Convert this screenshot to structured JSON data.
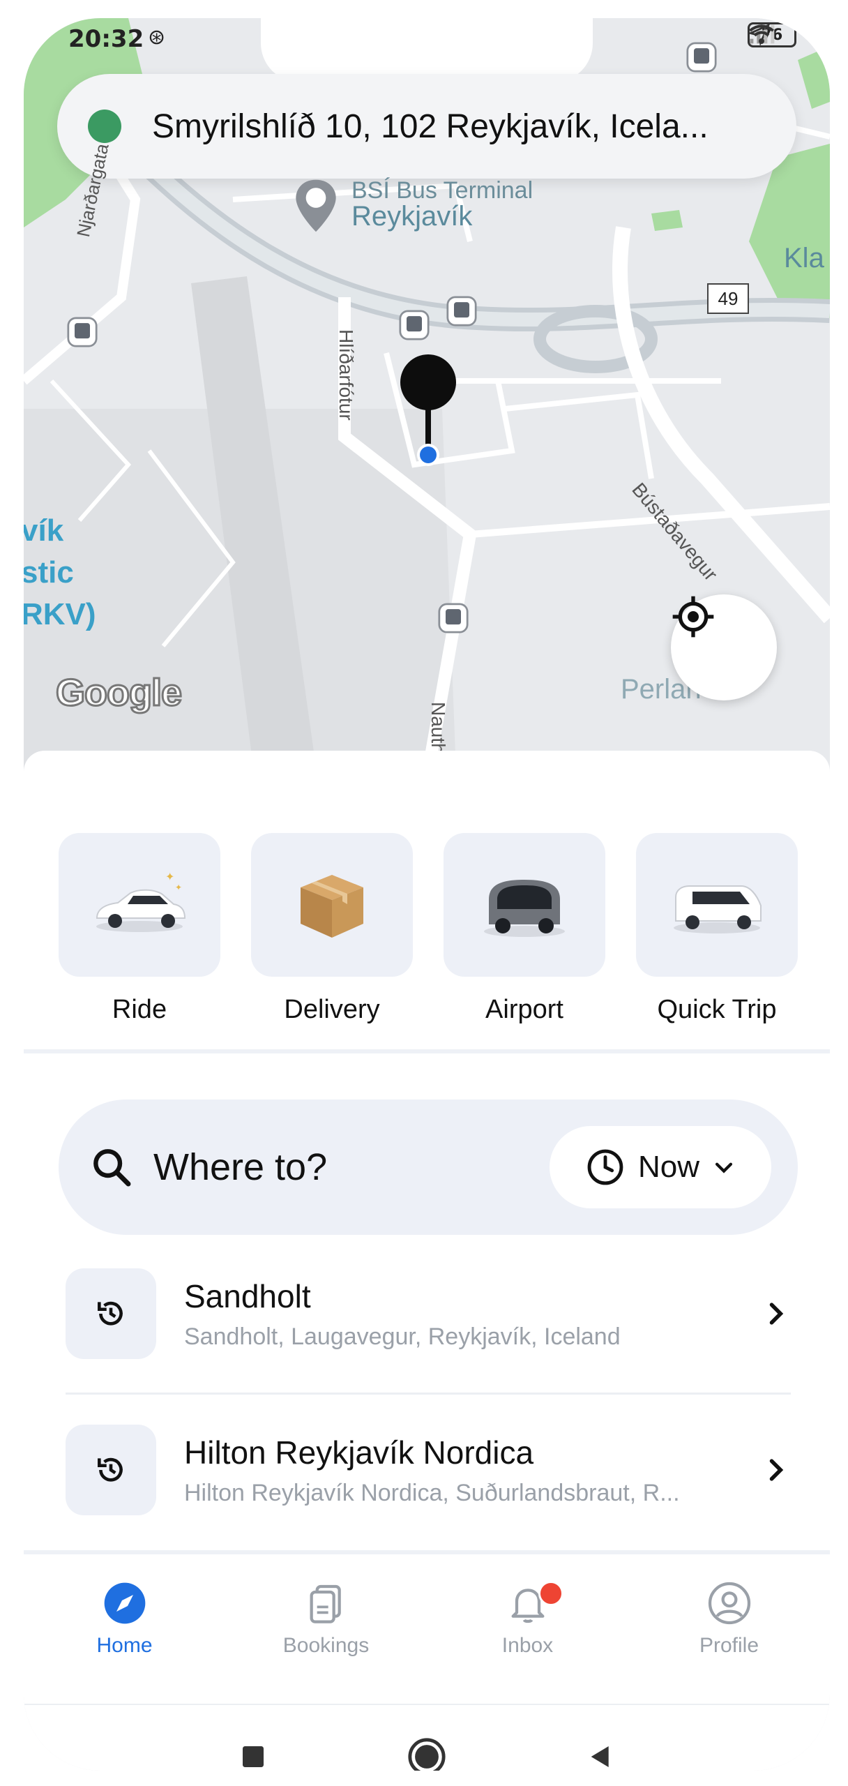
{
  "status_bar": {
    "time": "20:32",
    "sync_glyph": "⊛",
    "battery": "76"
  },
  "map": {
    "address": "Smyrilshlíð 10, 102 Reykjavík, Icela...",
    "labels": {
      "bsi": "BSÍ Bus Terminal",
      "reykjavik": "Reykjavík",
      "njardargata": "Njarðargata",
      "hlidarfotur": "Hlíðarfótur",
      "bustadavegur": "Bústaðavegur",
      "nauth": "Nauth",
      "perlan": "Perlan",
      "airport_1": "vík",
      "airport_2": "stic",
      "airport_3": "RKV)",
      "kla": "Kla",
      "route": "49"
    },
    "attribution": "Google",
    "colors": {
      "road": "#ffffff",
      "park": "#a8dba0",
      "label": "#5a8a9c",
      "accent": "#3b9a62"
    }
  },
  "services": [
    {
      "label": "Ride"
    },
    {
      "label": "Delivery"
    },
    {
      "label": "Airport"
    },
    {
      "label": "Quick Trip"
    }
  ],
  "search": {
    "placeholder": "Where to?",
    "time_label": "Now"
  },
  "recents": [
    {
      "title": "Sandholt",
      "subtitle": "Sandholt, Laugavegur, Reykjavík, Iceland"
    },
    {
      "title": "Hilton Reykjavík Nordica",
      "subtitle": "Hilton Reykjavík Nordica, Suðurlandsbraut, R..."
    }
  ],
  "tabs": [
    {
      "label": "Home",
      "icon": "compass-icon",
      "active": true
    },
    {
      "label": "Bookings",
      "icon": "documents-icon",
      "active": false
    },
    {
      "label": "Inbox",
      "icon": "bell-icon",
      "active": false
    },
    {
      "label": "Profile",
      "icon": "user-icon",
      "active": false
    }
  ],
  "accent_color": "#1f6fe0",
  "badge_color": "#ee4433"
}
